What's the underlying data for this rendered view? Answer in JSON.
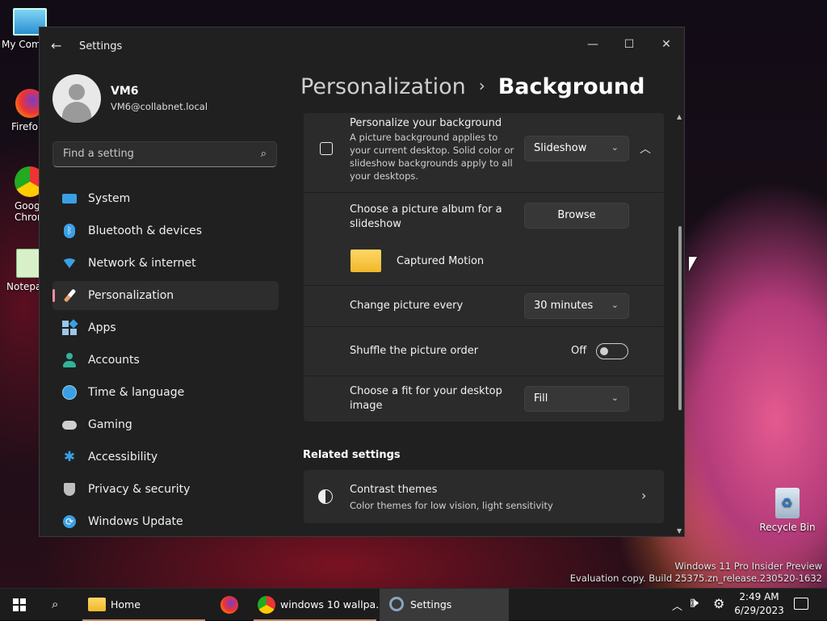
{
  "desktop": {
    "icons": [
      {
        "label": "My Com",
        "icon": "monitor-icon"
      },
      {
        "label": "Firefo",
        "icon": "firefox-icon"
      },
      {
        "label": "Goog\nChron",
        "icon": "chrome-icon"
      },
      {
        "label": "Notepa",
        "icon": "notepad-icon"
      }
    ],
    "recycle_bin": "Recycle Bin",
    "watermark_line1": "Windows 11 Pro Insider Preview",
    "watermark_line2": "Evaluation copy. Build 25375.zn_release.230520-1632"
  },
  "window": {
    "title": "Settings",
    "controls": {
      "minimize": "—",
      "maximize": "☐",
      "close": "✕"
    }
  },
  "user": {
    "name": "VM6",
    "email": "VM6@collabnet.local"
  },
  "search": {
    "placeholder": "Find a setting"
  },
  "nav": [
    {
      "label": "System",
      "icon": "system-icon",
      "color": "#3aa0e6"
    },
    {
      "label": "Bluetooth & devices",
      "icon": "bluetooth-icon",
      "color": "#3aa0e6"
    },
    {
      "label": "Network & internet",
      "icon": "wifi-icon",
      "color": "#3aa0e6"
    },
    {
      "label": "Personalization",
      "icon": "brush-icon",
      "color": "#e8a06a",
      "active": true
    },
    {
      "label": "Apps",
      "icon": "apps-icon",
      "color": "#9cc7ea"
    },
    {
      "label": "Accounts",
      "icon": "accounts-icon",
      "color": "#2fb39a"
    },
    {
      "label": "Time & language",
      "icon": "clock-globe-icon",
      "color": "#3aa0e6"
    },
    {
      "label": "Gaming",
      "icon": "gamepad-icon",
      "color": "#cfcfcf"
    },
    {
      "label": "Accessibility",
      "icon": "accessibility-icon",
      "color": "#3aa0e6"
    },
    {
      "label": "Privacy & security",
      "icon": "shield-icon",
      "color": "#bfbfbf"
    },
    {
      "label": "Windows Update",
      "icon": "update-icon",
      "color": "#3aa0e6"
    }
  ],
  "breadcrumb": {
    "parent": "Personalization",
    "separator": "›",
    "current": "Background"
  },
  "background": {
    "title": "Personalize your background",
    "description": "A picture background applies to your current desktop. Solid color or slideshow backgrounds apply to all your desktops.",
    "mode": "Slideshow",
    "album": {
      "label": "Choose a picture album for a slideshow",
      "button": "Browse",
      "folder": "Captured Motion"
    },
    "interval": {
      "label": "Change picture every",
      "value": "30 minutes"
    },
    "shuffle": {
      "label": "Shuffle the picture order",
      "state": "Off"
    },
    "fit": {
      "label": "Choose a fit for your desktop image",
      "value": "Fill"
    }
  },
  "related": {
    "heading": "Related settings",
    "contrast": {
      "title": "Contrast themes",
      "subtitle": "Color themes for low vision, light sensitivity"
    }
  },
  "taskbar": {
    "home": "Home",
    "chrome": "windows 10 wallpa...",
    "settings": "Settings",
    "time": "2:49 AM",
    "date": "6/29/2023"
  }
}
